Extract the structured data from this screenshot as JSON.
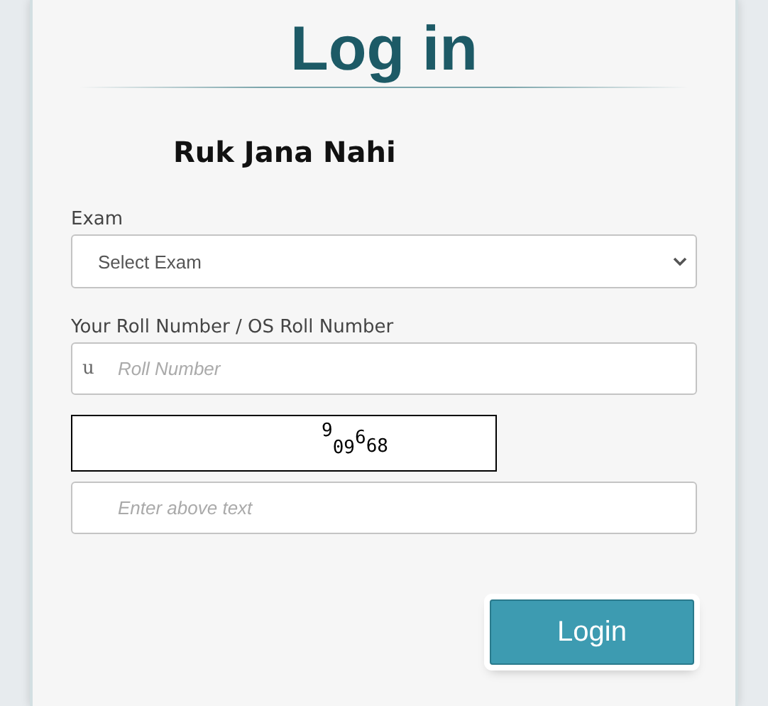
{
  "title": "Log in",
  "subtitle": "Ruk Jana Nahi",
  "exam": {
    "label": "Exam",
    "placeholder": "Select Exam"
  },
  "roll_number": {
    "label": "Your Roll Number / OS Roll Number",
    "icon_char": "u",
    "placeholder": "Roll Number"
  },
  "captcha": {
    "text": "909668"
  },
  "captcha_answer": {
    "placeholder": "Enter above text"
  },
  "buttons": [
    "Login"
  ]
}
